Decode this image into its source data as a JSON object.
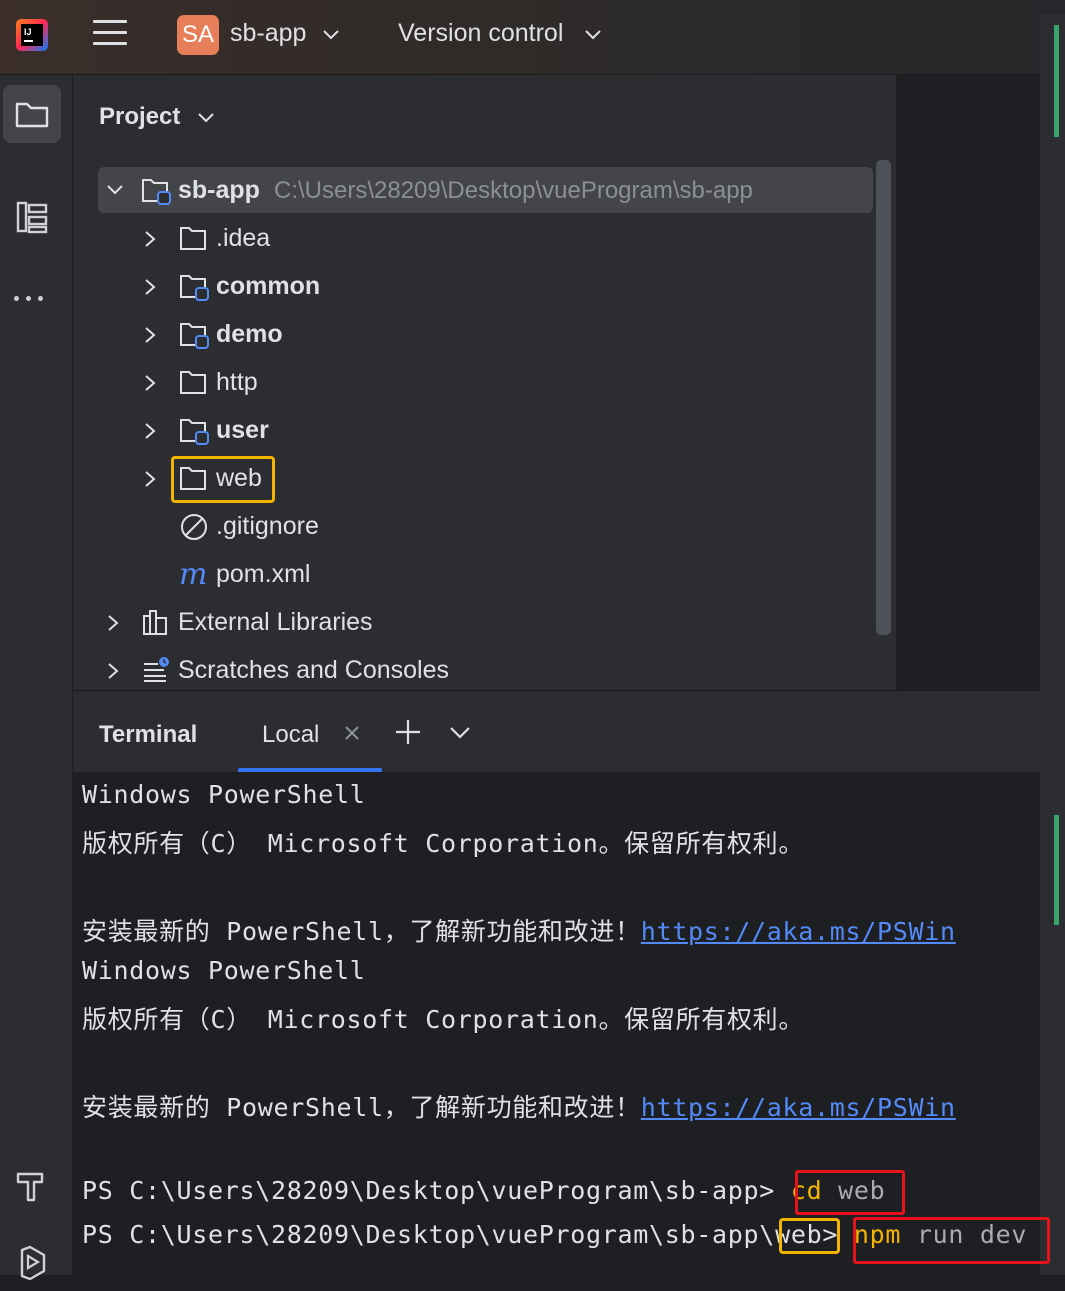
{
  "titlebar": {
    "project_badge": "SA",
    "project_name": "sb-app",
    "vcs_label": "Version control",
    "colors": {
      "badge": "#e67e5a"
    }
  },
  "toolstrip": {
    "items": [
      {
        "name": "project",
        "icon": "folder-icon",
        "active": true
      },
      {
        "name": "structure",
        "icon": "structure-icon",
        "active": false
      },
      {
        "name": "more",
        "icon": "more-icon",
        "active": false
      },
      {
        "name": "build",
        "icon": "hammer-icon",
        "active": false
      },
      {
        "name": "run",
        "icon": "run-icon",
        "active": false
      }
    ]
  },
  "project_panel": {
    "title": "Project",
    "root": {
      "label": "sb-app",
      "path": "C:\\Users\\28209\\Desktop\\vueProgram\\sb-app"
    },
    "items": [
      {
        "label": ".idea",
        "icon": "folder-icon",
        "bold": false,
        "expandable": true
      },
      {
        "label": "common",
        "icon": "module-folder-icon",
        "bold": true,
        "expandable": true
      },
      {
        "label": "demo",
        "icon": "module-folder-icon",
        "bold": true,
        "expandable": true
      },
      {
        "label": "http",
        "icon": "folder-icon",
        "bold": false,
        "expandable": true
      },
      {
        "label": "user",
        "icon": "module-folder-icon",
        "bold": true,
        "expandable": true
      },
      {
        "label": "web",
        "icon": "folder-icon",
        "bold": false,
        "expandable": true,
        "highlighted": true
      },
      {
        "label": ".gitignore",
        "icon": "ignored-file-icon",
        "bold": false,
        "expandable": false
      },
      {
        "label": "pom.xml",
        "icon": "maven-icon",
        "bold": false,
        "expandable": false
      }
    ],
    "external_libraries": "External Libraries",
    "scratches": "Scratches and Consoles"
  },
  "terminal": {
    "title": "Terminal",
    "tab_label": "Local",
    "lines": [
      "Windows PowerShell",
      "版权所有（C） Microsoft Corporation。保留所有权利。",
      "",
      "安装最新的 PowerShell，了解新功能和改进！",
      "Windows PowerShell",
      "版权所有（C） Microsoft Corporation。保留所有权利。",
      "",
      "安装最新的 PowerShell，了解新功能和改进！"
    ],
    "link_text": "https://aka.ms/PSWin",
    "prompt_1": "PS C:\\Users\\28209\\Desktop\\vueProgram\\sb-app> ",
    "cmd_1_name": "cd",
    "cmd_1_arg": " web",
    "prompt_2_prefix": "PS C:\\Users\\28209\\Desktop\\vueProgram\\sb-app\\",
    "prompt_2_dir": "web",
    "prompt_2_suffix": "> ",
    "cmd_2_name": "npm",
    "cmd_2_arg": " run dev",
    "colors": {
      "link": "#548af7",
      "command": "#f5b400",
      "highlight_yellow": "#f5b400",
      "highlight_red": "#e5141b",
      "tab_underline": "#3574f0"
    }
  }
}
